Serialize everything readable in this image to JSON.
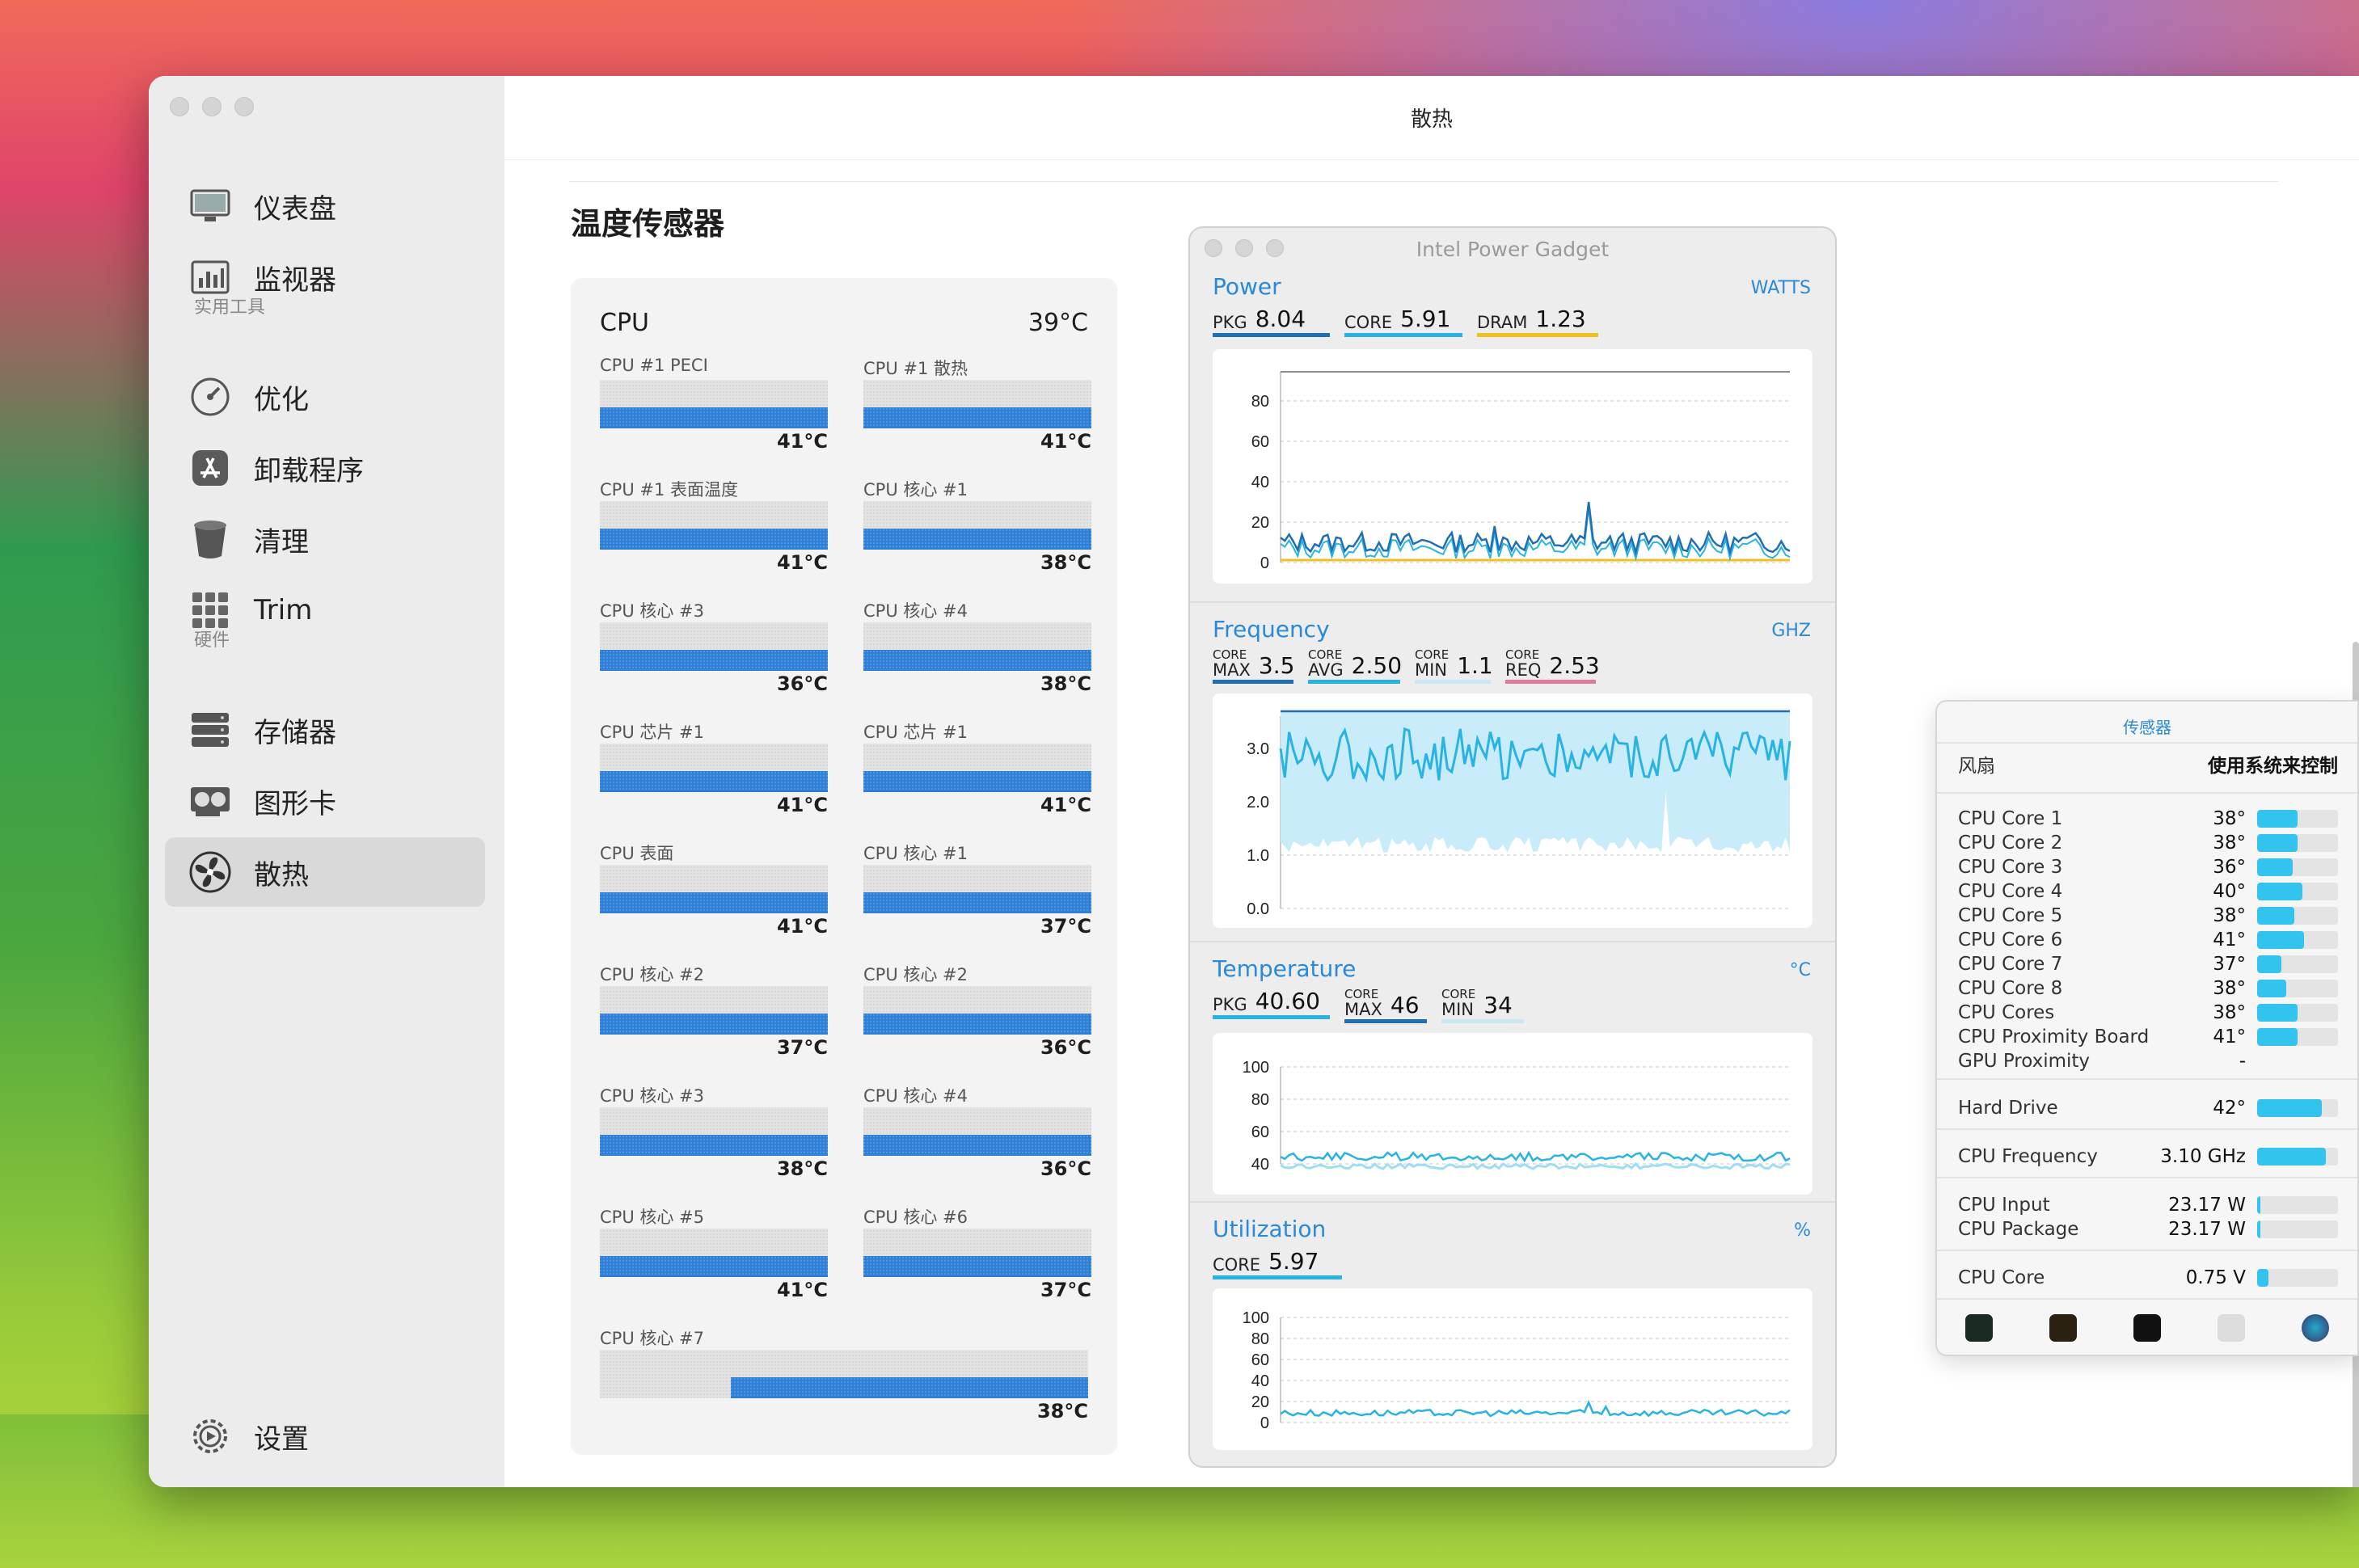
{
  "window": {
    "title": "散热"
  },
  "sidebar": {
    "items": [
      {
        "label": "仪表盘",
        "icon": "monitor-icon"
      },
      {
        "label": "监视器",
        "icon": "bar-chart-icon"
      },
      {
        "label": "优化",
        "icon": "gauge-icon"
      },
      {
        "label": "卸载程序",
        "icon": "appstore-icon"
      },
      {
        "label": "清理",
        "icon": "trash-icon"
      },
      {
        "label": "Trim",
        "icon": "grid-icon"
      },
      {
        "label": "存储器",
        "icon": "storage-icon"
      },
      {
        "label": "图形卡",
        "icon": "gpu-icon"
      },
      {
        "label": "散热",
        "icon": "fan-icon"
      }
    ],
    "section_tools": "实用工具",
    "section_hardware": "硬件",
    "settings_label": "设置",
    "active": "散热"
  },
  "page": {
    "heading": "温度传感器"
  },
  "cpu": {
    "title": "CPU",
    "temp": "39°C",
    "sensors": [
      {
        "name": "CPU #1 PECI",
        "value": "41°C"
      },
      {
        "name": "CPU #1 散热",
        "value": "41°C"
      },
      {
        "name": "CPU #1 表面温度",
        "value": "41°C"
      },
      {
        "name": "CPU 核心 #1",
        "value": "38°C"
      },
      {
        "name": "CPU 核心 #3",
        "value": "36°C"
      },
      {
        "name": "CPU 核心 #4",
        "value": "38°C"
      },
      {
        "name": "CPU 芯片 #1",
        "value": "41°C"
      },
      {
        "name": "CPU 芯片 #1",
        "value": "41°C"
      },
      {
        "name": "CPU 表面",
        "value": "41°C"
      },
      {
        "name": "CPU 核心 #1",
        "value": "37°C"
      },
      {
        "name": "CPU 核心 #2",
        "value": "37°C"
      },
      {
        "name": "CPU 核心 #2",
        "value": "36°C"
      },
      {
        "name": "CPU 核心 #3",
        "value": "38°C"
      },
      {
        "name": "CPU 核心 #4",
        "value": "36°C"
      },
      {
        "name": "CPU 核心 #5",
        "value": "41°C"
      },
      {
        "name": "CPU 核心 #6",
        "value": "37°C"
      },
      {
        "name": "CPU 核心 #7",
        "value": "38°C"
      }
    ]
  },
  "ipg": {
    "title": "Intel Power Gadget",
    "power": {
      "title": "Power",
      "unit": "WATTS",
      "metrics": [
        {
          "label": "PKG",
          "value": "8.04",
          "color": "#1f6fb5"
        },
        {
          "label": "CORE",
          "value": "5.91",
          "color": "#29b3e3"
        },
        {
          "label": "DRAM",
          "value": "1.23",
          "color": "#f0c020"
        }
      ],
      "ticks": [
        "80",
        "60",
        "40",
        "20",
        "0"
      ]
    },
    "frequency": {
      "title": "Frequency",
      "unit": "GHZ",
      "metrics": [
        {
          "top": "CORE",
          "label": "MAX",
          "value": "3.5",
          "color": "#1f6fb5"
        },
        {
          "top": "CORE",
          "label": "AVG",
          "value": "2.50",
          "color": "#29b3e3"
        },
        {
          "top": "CORE",
          "label": "MIN",
          "value": "1.1",
          "color": "#c9e8f6"
        },
        {
          "top": "CORE",
          "label": "REQ",
          "value": "2.53",
          "color": "#e07a9e"
        }
      ],
      "ticks": [
        "3.0",
        "2.0",
        "1.0",
        "0.0"
      ]
    },
    "temperature": {
      "title": "Temperature",
      "unit": "°C",
      "metrics": [
        {
          "label": "PKG",
          "value": "40.60",
          "color": "#29b3e3"
        },
        {
          "top": "CORE",
          "label": "MAX",
          "value": "46",
          "color": "#1f6fb5"
        },
        {
          "top": "CORE",
          "label": "MIN",
          "value": "34",
          "color": "#c9e8f6"
        }
      ],
      "ticks": [
        "100",
        "80",
        "60",
        "40"
      ]
    },
    "utilization": {
      "title": "Utilization",
      "unit": "%",
      "metrics": [
        {
          "label": "CORE",
          "value": "5.97",
          "color": "#29b3e3"
        }
      ],
      "ticks": [
        "100",
        "80",
        "60",
        "40",
        "20",
        "0"
      ]
    }
  },
  "popover": {
    "title": "传感器",
    "fan_label": "风扇",
    "fan_value": "使用系统来控制",
    "cores": [
      {
        "name": "CPU Core 1",
        "value": "38°",
        "level": 0.5
      },
      {
        "name": "CPU Core 2",
        "value": "38°",
        "level": 0.5
      },
      {
        "name": "CPU Core 3",
        "value": "36°",
        "level": 0.44
      },
      {
        "name": "CPU Core 4",
        "value": "40°",
        "level": 0.56
      },
      {
        "name": "CPU Core 5",
        "value": "38°",
        "level": 0.46
      },
      {
        "name": "CPU Core 6",
        "value": "41°",
        "level": 0.58
      },
      {
        "name": "CPU Core 7",
        "value": "37°",
        "level": 0.3
      },
      {
        "name": "CPU Core 8",
        "value": "38°",
        "level": 0.36
      },
      {
        "name": "CPU Cores",
        "value": "38°",
        "level": 0.5
      },
      {
        "name": "CPU Proximity Board",
        "value": "41°",
        "level": 0.5
      },
      {
        "name": "GPU Proximity",
        "value": "-",
        "level": 0
      }
    ],
    "hard_drive": {
      "name": "Hard Drive",
      "value": "42°",
      "level": 0.8
    },
    "cpu_frequency": {
      "name": "CPU Frequency",
      "value": "3.10 GHz",
      "level": 0.85
    },
    "cpu_input": {
      "name": "CPU Input",
      "value": "23.17 W",
      "level": 0.04
    },
    "cpu_package": {
      "name": "CPU Package",
      "value": "23.17 W",
      "level": 0.04
    },
    "cpu_core_v": {
      "name": "CPU Core",
      "value": "0.75 V",
      "level": 0.14
    }
  }
}
